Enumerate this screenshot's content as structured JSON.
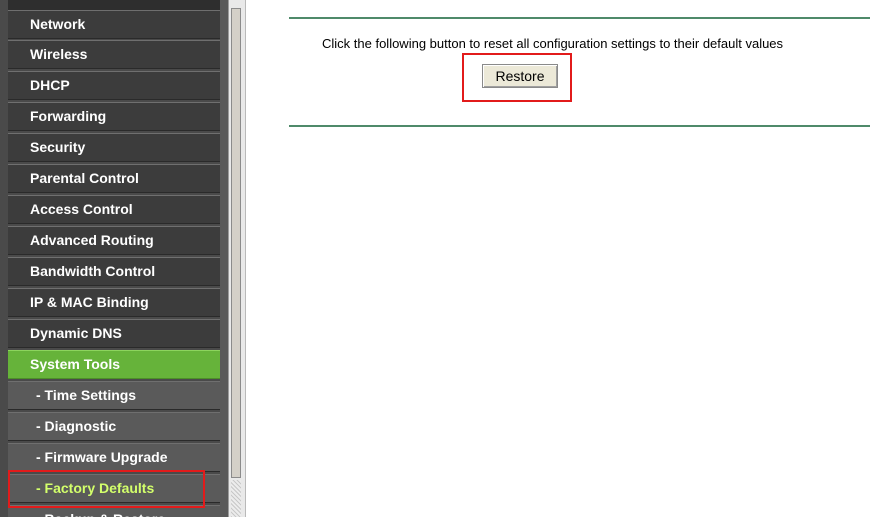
{
  "sidebar": {
    "items": [
      {
        "label": "Network",
        "kind": "main"
      },
      {
        "label": "Wireless",
        "kind": "main"
      },
      {
        "label": "DHCP",
        "kind": "main"
      },
      {
        "label": "Forwarding",
        "kind": "main"
      },
      {
        "label": "Security",
        "kind": "main"
      },
      {
        "label": "Parental Control",
        "kind": "main"
      },
      {
        "label": "Access Control",
        "kind": "main"
      },
      {
        "label": "Advanced Routing",
        "kind": "main"
      },
      {
        "label": "Bandwidth Control",
        "kind": "main"
      },
      {
        "label": "IP & MAC Binding",
        "kind": "main"
      },
      {
        "label": "Dynamic DNS",
        "kind": "main"
      },
      {
        "label": "System Tools",
        "kind": "active"
      },
      {
        "label": "- Time Settings",
        "kind": "sub"
      },
      {
        "label": "- Diagnostic",
        "kind": "sub"
      },
      {
        "label": "- Firmware Upgrade",
        "kind": "sub"
      },
      {
        "label": "- Factory Defaults",
        "kind": "current"
      },
      {
        "label": "- Backup & Restore",
        "kind": "sub"
      }
    ]
  },
  "main": {
    "description": "Click the following button to reset all configuration settings to their default values",
    "restore_label": "Restore"
  },
  "colors": {
    "active_green": "#66b33a",
    "current_text": "#d3ff6b",
    "highlight_red": "#e21b1b",
    "rule_green": "#4f8a6a"
  }
}
